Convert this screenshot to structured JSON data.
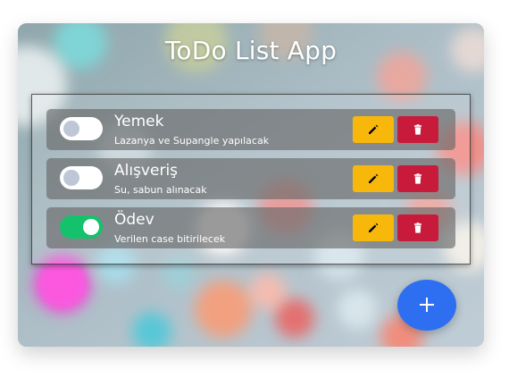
{
  "app": {
    "title": "ToDo List App"
  },
  "todos": [
    {
      "name": "Yemek",
      "description": "Lazanya ve Supangle yapılacak",
      "done": false
    },
    {
      "name": "Alışveriş",
      "description": "Su, sabun alınacak",
      "done": false
    },
    {
      "name": "Ödev",
      "description": "Verilen case bitirilecek",
      "done": true
    }
  ],
  "icons": {
    "edit": "pencil-icon",
    "delete": "trash-icon",
    "add": "plus-icon"
  },
  "colors": {
    "toggle_on": "#14c26c",
    "edit_button": "#f7b80b",
    "delete_button": "#c81b3b",
    "add_button": "#2e6ff2"
  }
}
